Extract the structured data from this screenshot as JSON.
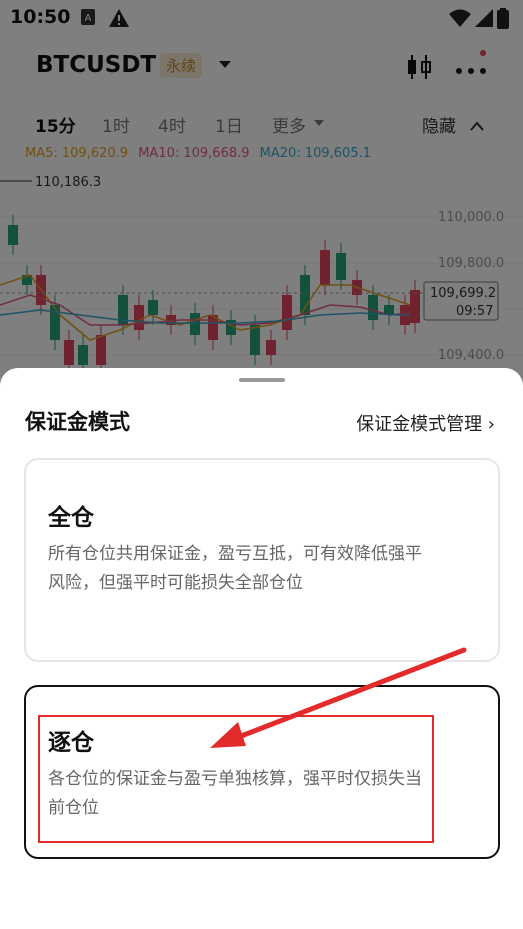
{
  "status_bar": {
    "time": "10:50"
  },
  "header": {
    "symbol": "BTCUSDT",
    "contract_badge": "永续"
  },
  "timeframes": {
    "items": [
      "15分",
      "1时",
      "4时",
      "1日"
    ],
    "more": "更多",
    "hide": "隐藏"
  },
  "moving_averages": {
    "ma5": "MA5: 109,620.9",
    "ma10": "MA10: 109,668.9",
    "ma20": "MA20: 109,605.1",
    "colors": {
      "ma5": "#e0a020",
      "ma10": "#e05a7a",
      "ma20": "#3aa6c8"
    }
  },
  "chart": {
    "high_label": "110,186.3",
    "price_axis": [
      "110,000.0",
      "109,800.0",
      "109,400.0"
    ],
    "current_price": "109,699.2",
    "countdown": "09:57",
    "colors": {
      "up": "#26a27a",
      "down": "#e0455f"
    }
  },
  "sheet": {
    "title": "保证金模式",
    "manage_link": "保证金模式管理 ›",
    "options": [
      {
        "title": "全仓",
        "description": "所有仓位共用保证金，盈亏互抵，可有效降低强平风险，但强平时可能损失全部仓位"
      },
      {
        "title": "逐仓",
        "description": "各仓位的保证金与盈亏单独核算，强平时仅损失当前仓位"
      }
    ]
  },
  "annotation_colors": {
    "arrow": "#e32b2b"
  }
}
